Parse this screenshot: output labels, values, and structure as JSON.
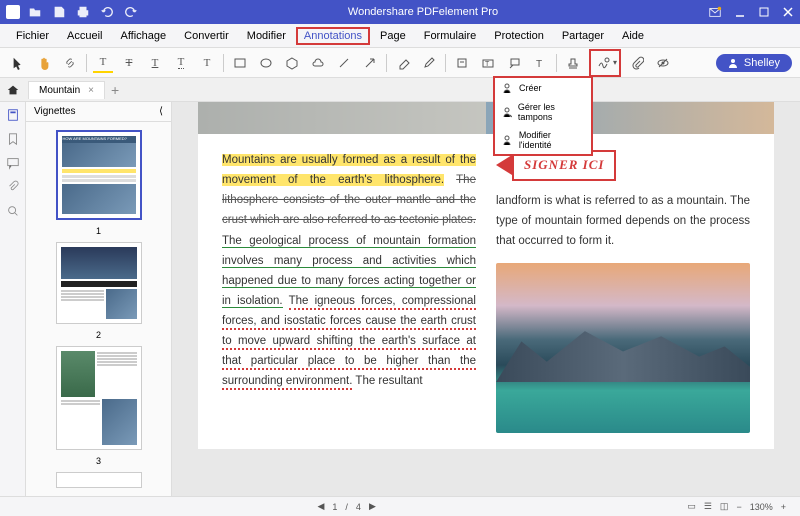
{
  "titlebar": {
    "title": "Wondershare PDFelement Pro"
  },
  "menubar": {
    "items": [
      "Fichier",
      "Accueil",
      "Affichage",
      "Convertir",
      "Modifier",
      "Annotations",
      "Page",
      "Formulaire",
      "Protection",
      "Partager",
      "Aide"
    ],
    "active_index": 5
  },
  "toolbar": {
    "user_label": "Shelley"
  },
  "dropdown": {
    "items": [
      "Créer",
      "Gérer les tampons",
      "Modifier l'identité"
    ]
  },
  "tabs": {
    "items": [
      {
        "label": "Mountain"
      }
    ]
  },
  "thumbs": {
    "title": "Vignettes",
    "pages": [
      "1",
      "2",
      "3"
    ]
  },
  "document": {
    "sign_here": "SIGNER ICI",
    "left_highlight": "Mountains are usually formed as a result of the movement of the earth's lithosphere.",
    "left_strike": "The lithosphere consists of the outer mantle and the crust which are also referred to as tectonic plates.",
    "left_green": "The geological process of mountain formation involves many process and activities which happened due to many forces acting together or in isolation.",
    "left_red_a": "The igneous forces, compressional forces, and isostatic forces cause the earth crust to move upward shifting the earth's surface at that particular place to be higher than the surrounding environment.",
    "left_tail": "The resultant",
    "right_text": "landform is what is referred to as a mountain. The type of mountain formed depends on the process that occurred to form it."
  },
  "status": {
    "page": "1",
    "total": "4",
    "zoom": "130%"
  }
}
